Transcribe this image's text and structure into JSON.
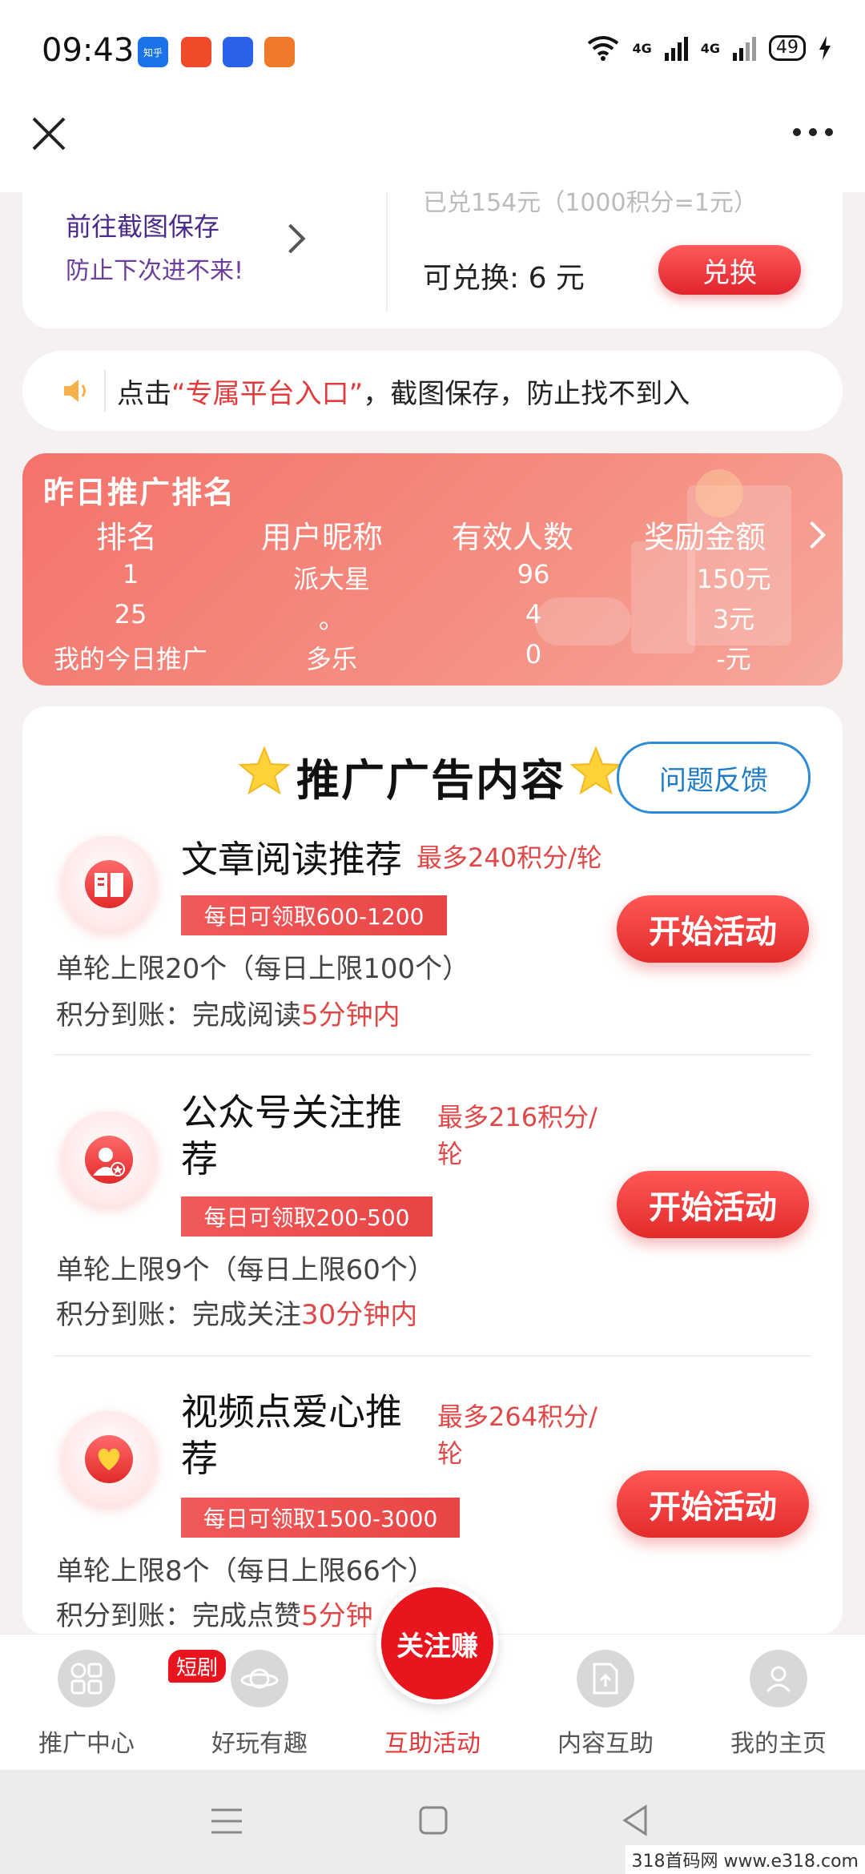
{
  "status_bar": {
    "time": "09:43",
    "apps": [
      {
        "name": "知乎",
        "color": "#1a73e8"
      },
      {
        "name": "",
        "color": "#f04a2a"
      },
      {
        "name": "",
        "color": "#2a62e8"
      },
      {
        "name": "",
        "color": "#f07a2a"
      }
    ],
    "network": [
      "4G",
      "4G"
    ],
    "battery": "49"
  },
  "top_card": {
    "go_save_title": "前往截图保存",
    "go_save_sub": "防止下次进不来!",
    "redeemed": "已兑154元（1000积分=1元）",
    "can_redeem": "可兑换: 6 元",
    "redeem_button": "兑换"
  },
  "notice": {
    "prefix": "点击",
    "highlight": "“专属平台入口”",
    "suffix": "，截图保存，防止找不到入"
  },
  "ranking": {
    "title": "昨日推广排名",
    "headers": [
      "排名",
      "用户昵称",
      "有效人数",
      "奖励金额"
    ],
    "rows": [
      [
        "1",
        "派大星",
        "96",
        "150元"
      ],
      [
        "25",
        "。",
        "4",
        "3元"
      ],
      [
        "我的今日推广",
        "多乐",
        "0",
        "-元"
      ]
    ]
  },
  "ads": {
    "title": "推广广告内容",
    "feedback_button": "问题反馈",
    "items": [
      {
        "name": "文章阅读推荐",
        "max": "最多240积分/轮",
        "daily": "每日可领取600-1200",
        "limit": "单轮上限20个（每日上限100个）",
        "arrive_prefix": "积分到账：完成阅读",
        "arrive_hl": "5分钟内",
        "button": "开始活动"
      },
      {
        "name": "公众号关注推荐",
        "max": "最多216积分/轮",
        "daily": "每日可领取200-500",
        "limit": "单轮上限9个（每日上限60个）",
        "arrive_prefix": "积分到账：完成关注",
        "arrive_hl": "30分钟内",
        "button": "开始活动"
      },
      {
        "name": "视频点爱心推荐",
        "max": "最多264积分/轮",
        "daily": "每日可领取1500-3000",
        "limit": "单轮上限8个（每日上限66个）",
        "arrive_prefix": "积分到账：完成点赞",
        "arrive_hl": "5分钟",
        "button": "开始活动"
      }
    ]
  },
  "bottom_nav": {
    "center_badge": "关注赚",
    "drama_badge": "短剧",
    "items": [
      {
        "label": "推广中心"
      },
      {
        "label": "好玩有趣"
      },
      {
        "label": "互助活动"
      },
      {
        "label": "内容互助"
      },
      {
        "label": "我的主页"
      }
    ]
  },
  "watermark": "318首码网  www.e318.com",
  "colors": {
    "accent": "#e23a3a",
    "feedback": "#2e8bd6",
    "rank_bg": "#f4736c"
  }
}
